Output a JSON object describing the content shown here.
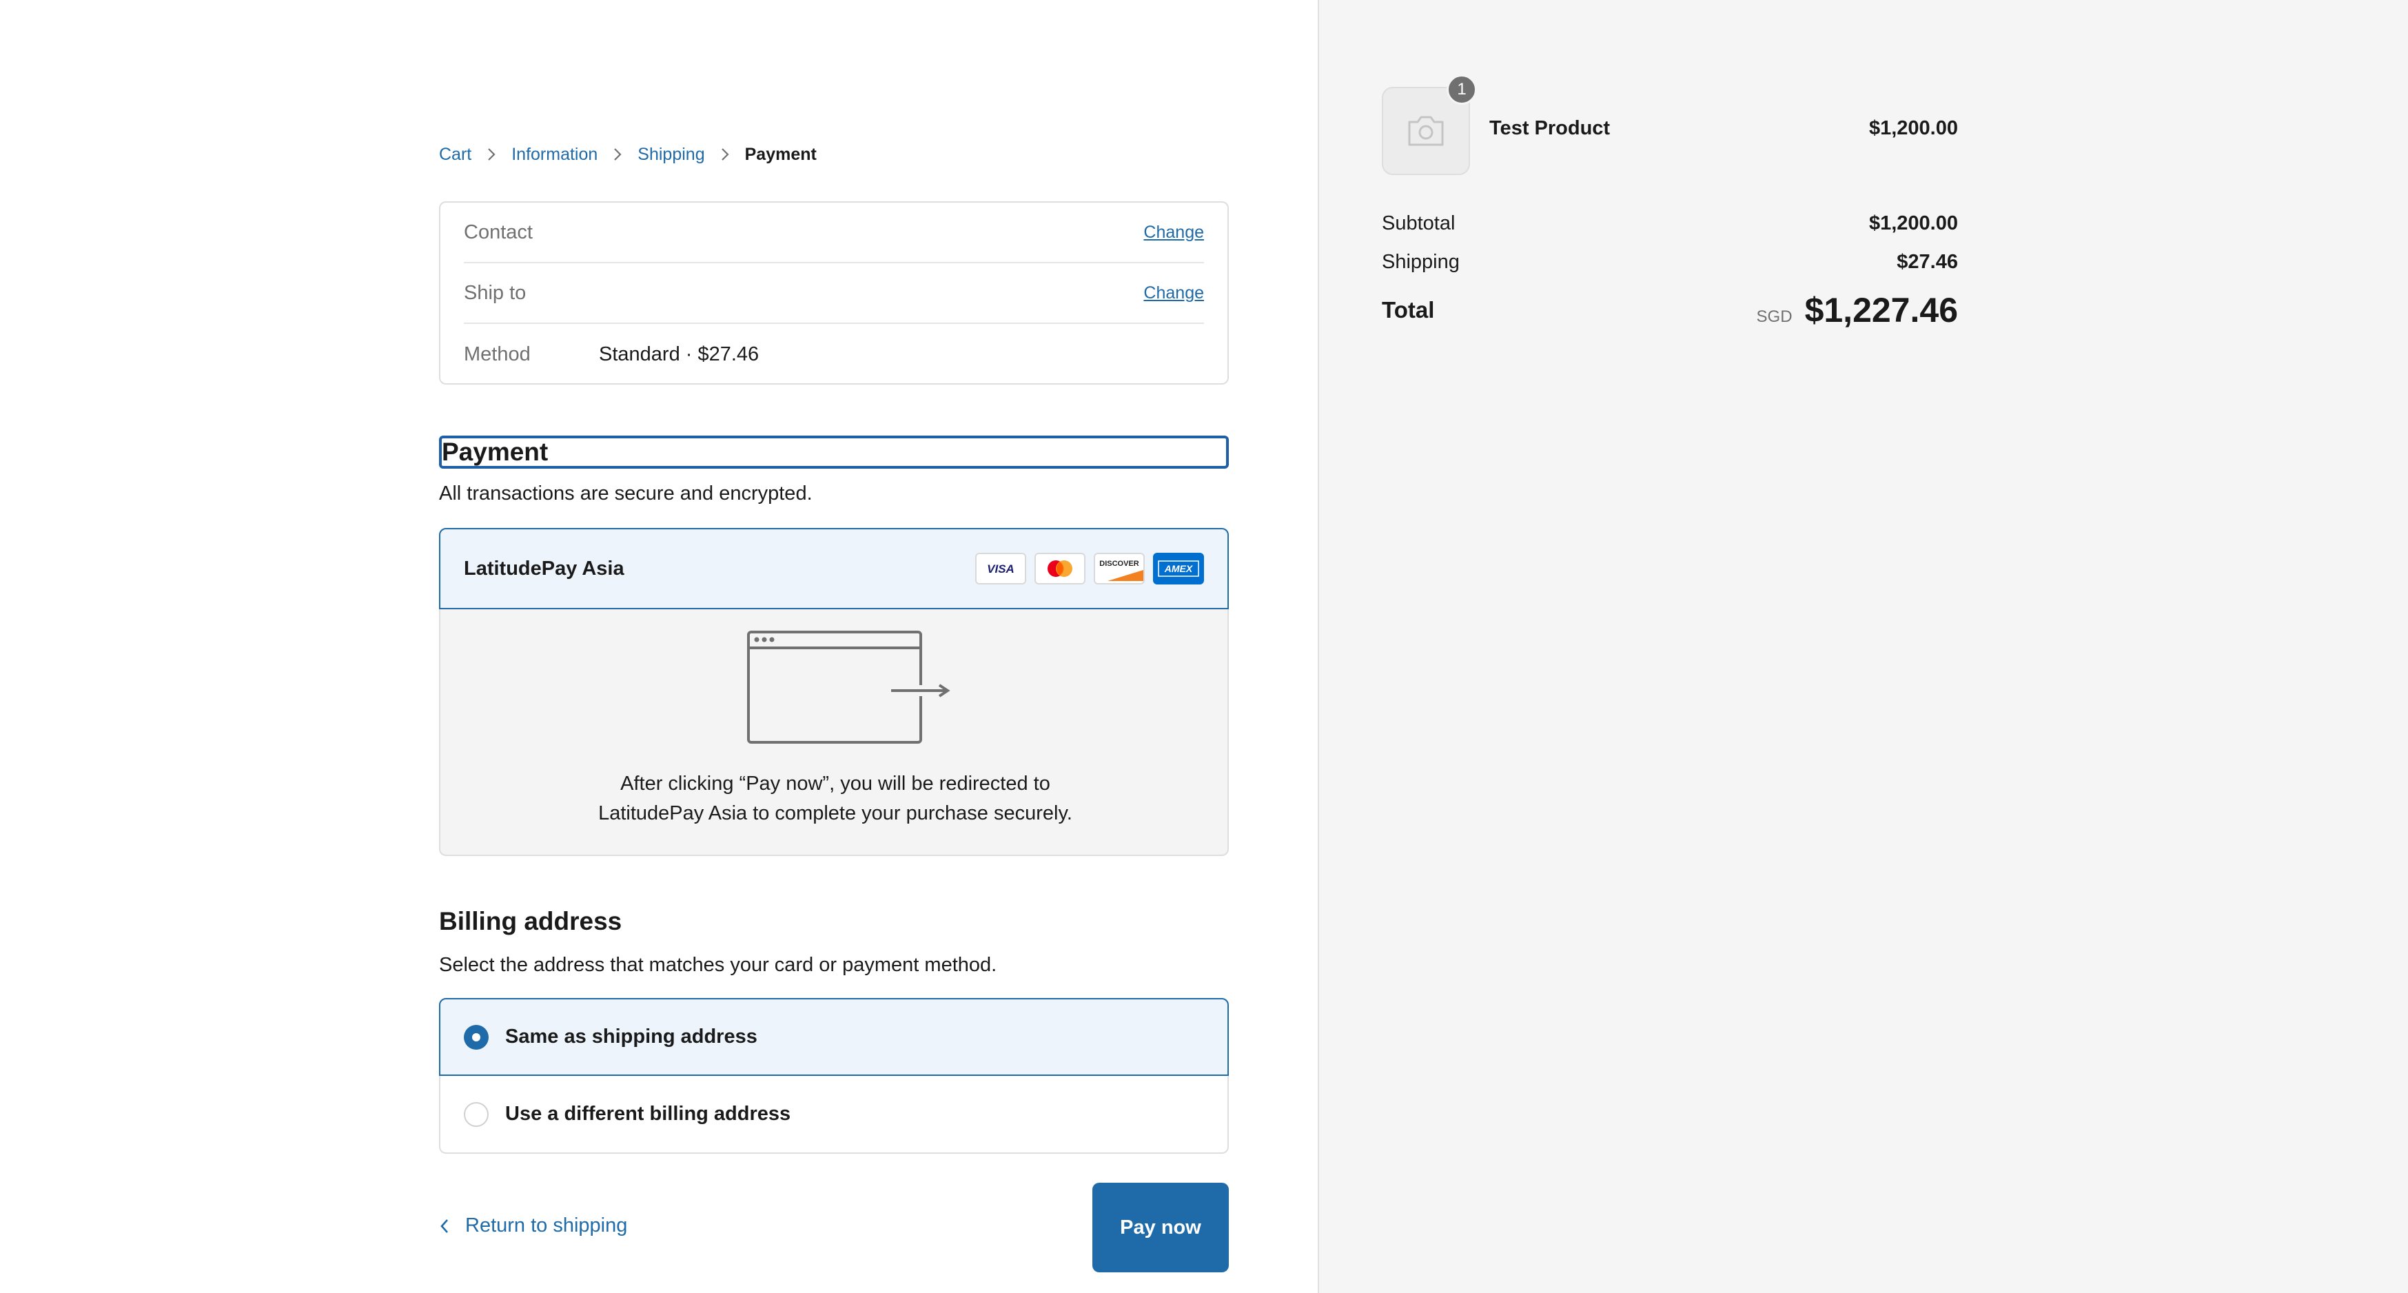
{
  "breadcrumb": {
    "cart": "Cart",
    "information": "Information",
    "shipping": "Shipping",
    "payment": "Payment"
  },
  "review": {
    "contact_label": "Contact",
    "contact_change": "Change",
    "shipto_label": "Ship to",
    "shipto_change": "Change",
    "method_label": "Method",
    "method_value": "Standard · $27.46"
  },
  "payment": {
    "heading": "Payment",
    "subtitle": "All transactions are secure and encrypted.",
    "gateway_name": "LatitudePay Asia",
    "card_logos": [
      "visa-logo",
      "mastercard-logo",
      "discover-logo",
      "amex-logo"
    ],
    "card_text": {
      "visa": "VISA",
      "discover": "DISCOVER",
      "amex": "AMEX"
    },
    "redirect_line1": "After clicking “Pay now”, you will be redirected to",
    "redirect_line2": "LatitudePay Asia to complete your purchase securely."
  },
  "billing": {
    "title": "Billing address",
    "subtitle": "Select the address that matches your card or payment method.",
    "options": [
      {
        "label": "Same as shipping address",
        "selected": true
      },
      {
        "label": "Use a different billing address",
        "selected": false
      }
    ]
  },
  "actions": {
    "return_label": "Return to shipping",
    "pay_label": "Pay now"
  },
  "summary": {
    "product": {
      "quantity": "1",
      "name": "Test Product",
      "price": "$1,200.00",
      "thumbnail_icon": "camera-icon"
    },
    "subtotal_label": "Subtotal",
    "subtotal_value": "$1,200.00",
    "shipping_label": "Shipping",
    "shipping_value": "$27.46",
    "total_label": "Total",
    "currency": "SGD",
    "total_value": "$1,227.46"
  },
  "colors": {
    "accent": "#1f6aa8",
    "selected_bg": "#eef4fc",
    "summary_bg": "#f5f5f5"
  }
}
